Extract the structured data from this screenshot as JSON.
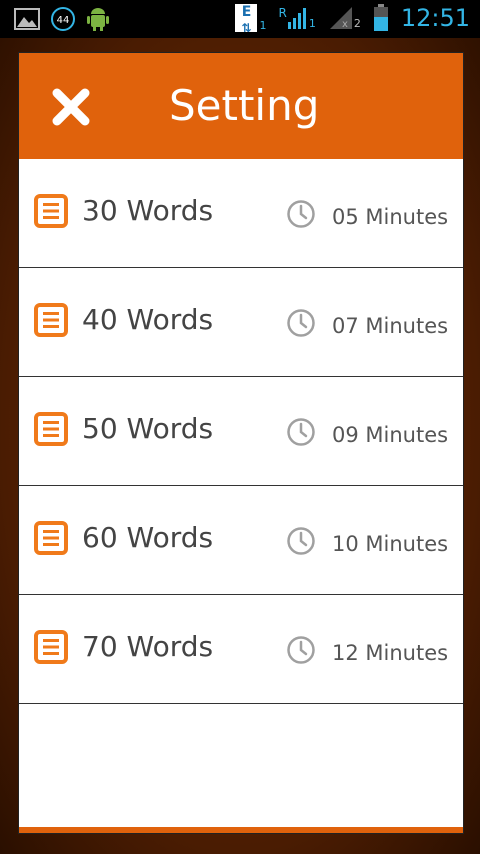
{
  "status_bar": {
    "notification_badge": "44",
    "data_label": "E",
    "data_sub": "1",
    "roaming_label": "R",
    "roaming_sub": "1",
    "sim2_sub": "2",
    "time": "12:51"
  },
  "dialog": {
    "title": "Setting",
    "accent_color": "#e0620c",
    "items": [
      {
        "words": "30 Words",
        "time": "05 Minutes"
      },
      {
        "words": "40 Words",
        "time": "07 Minutes"
      },
      {
        "words": "50 Words",
        "time": "09 Minutes"
      },
      {
        "words": "60 Words",
        "time": "10 Minutes"
      },
      {
        "words": "70 Words",
        "time": "12 Minutes"
      }
    ]
  }
}
